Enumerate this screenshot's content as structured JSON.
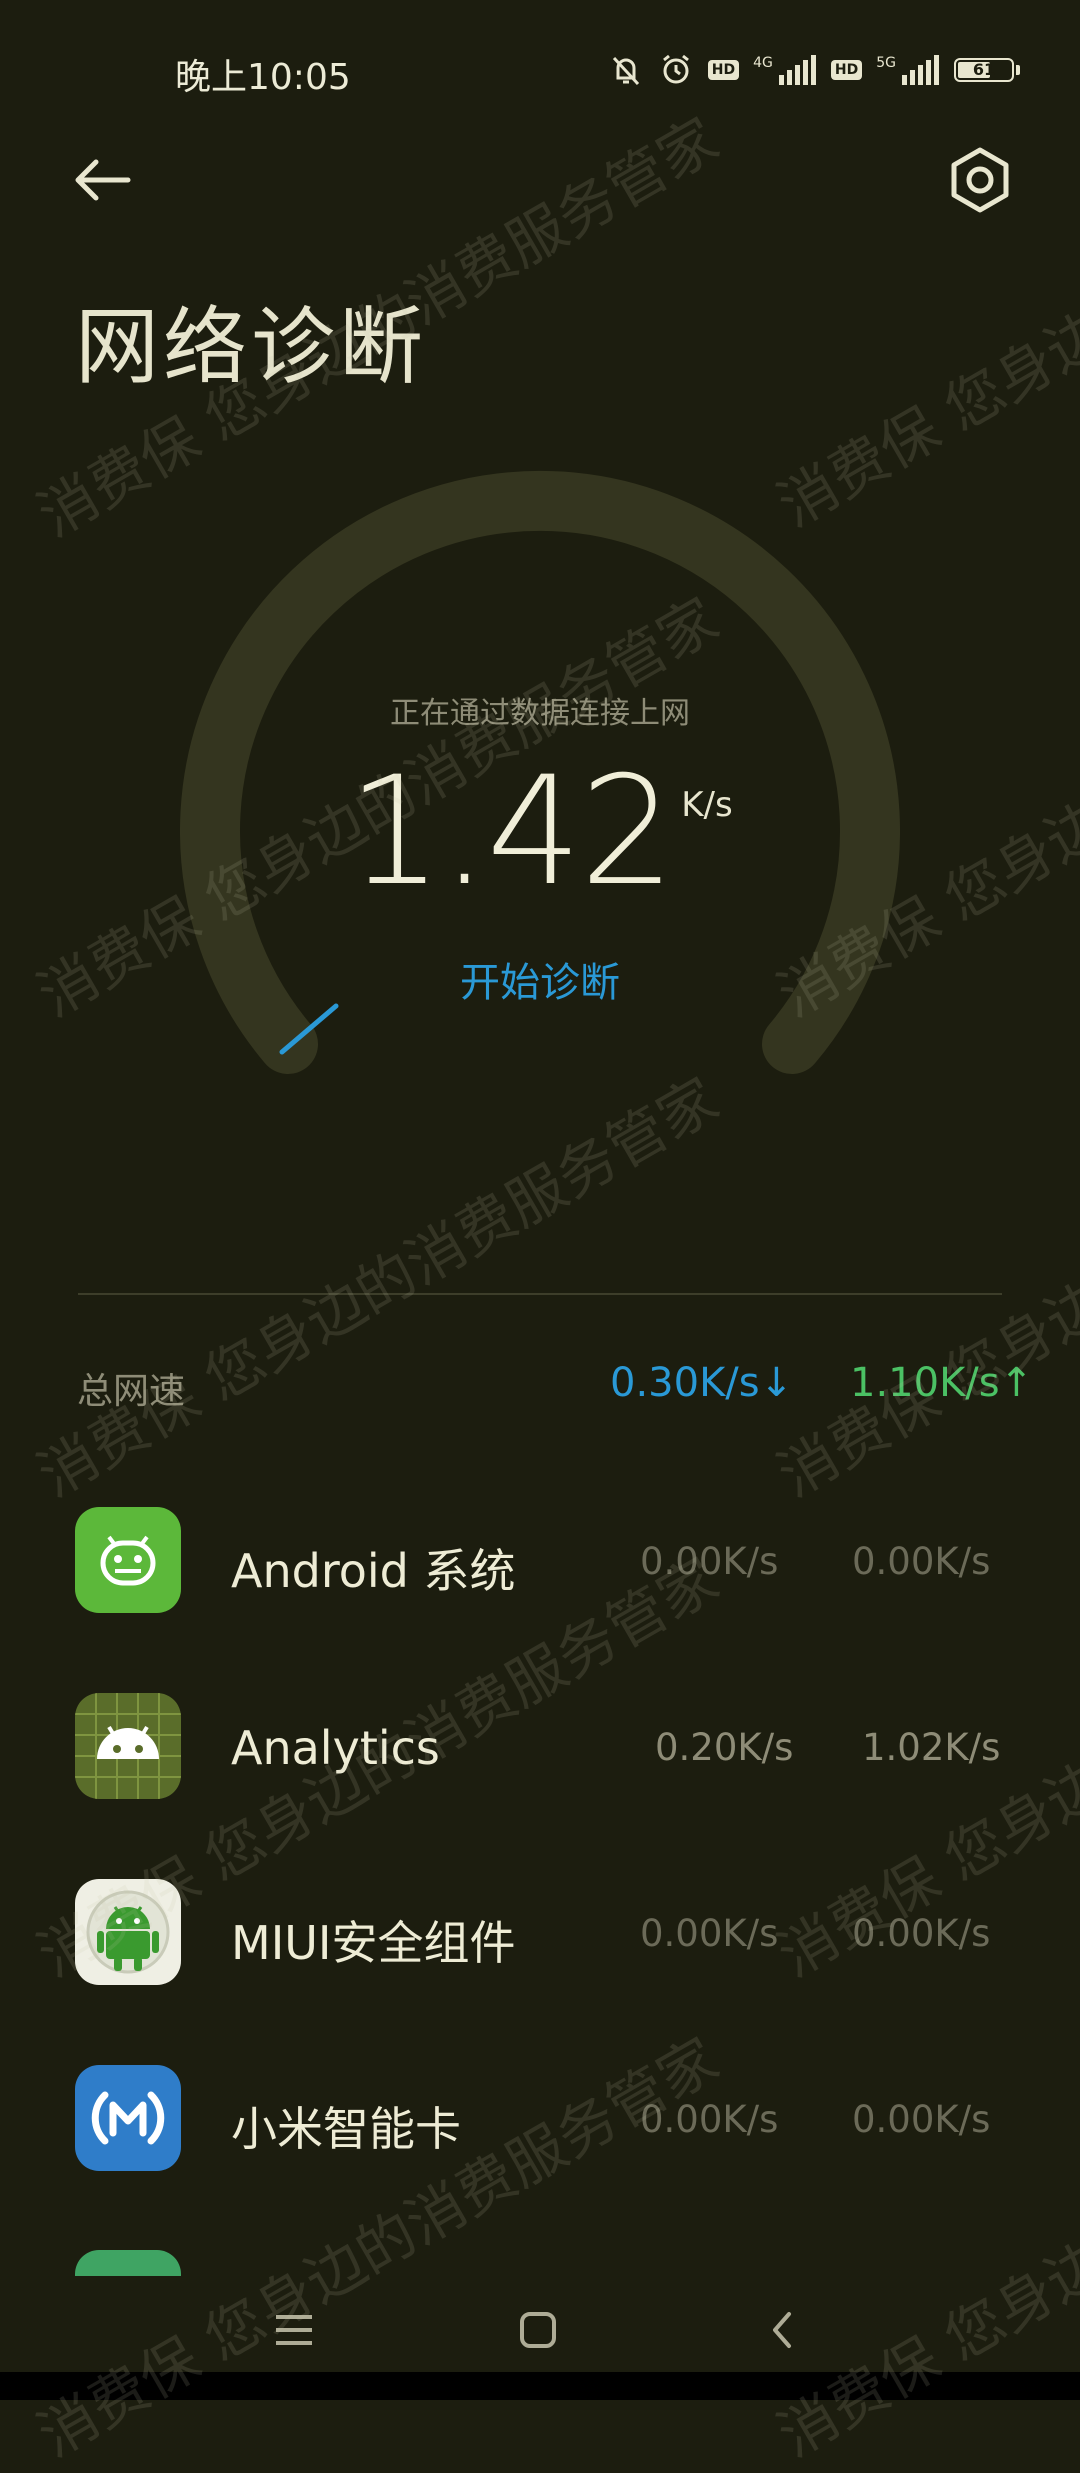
{
  "status_bar": {
    "time": "晚上10:05",
    "network_1": "4G",
    "network_2": "5G",
    "hd_1": "HD",
    "hd_2": "HD",
    "battery": "61"
  },
  "header": {
    "title": "网络诊断"
  },
  "gauge": {
    "subtitle": "正在通过数据连接上网",
    "speed": "1.42",
    "unit": "K/s",
    "action": "开始诊断"
  },
  "total": {
    "label": "总网速",
    "down": "0.30K/s↓",
    "up": "1.10K/s↑"
  },
  "apps": [
    {
      "name": "Android 系统",
      "down": "0.00K/s",
      "up": "0.00K/s"
    },
    {
      "name": "Analytics",
      "down": "0.20K/s",
      "up": "1.02K/s"
    },
    {
      "name": "MIUI安全组件",
      "down": "0.00K/s",
      "up": "0.00K/s"
    },
    {
      "name": "小米智能卡",
      "down": "0.00K/s",
      "up": "0.00K/s"
    }
  ],
  "watermark": "消费保 您身边的消费服务管家",
  "colors": {
    "background": "#1c1d0f",
    "accent_blue": "#2a99d6",
    "accent_green": "#4bc164"
  }
}
